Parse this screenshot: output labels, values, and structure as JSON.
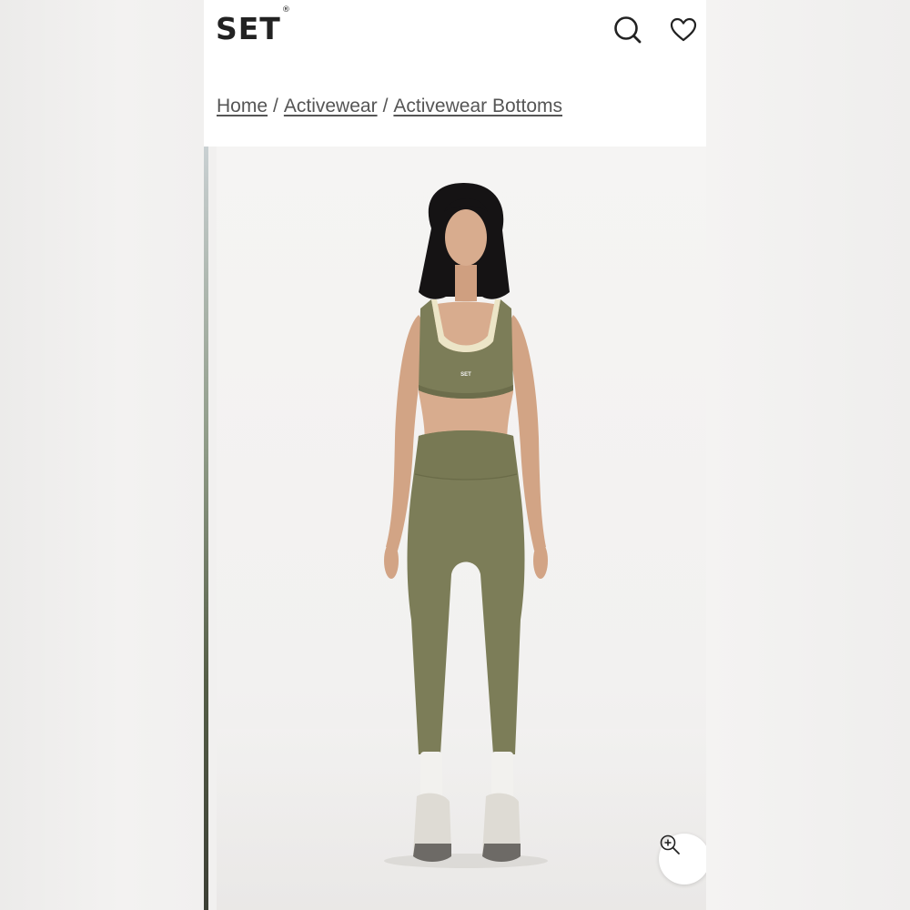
{
  "brand": {
    "logo_text": "SET",
    "logo_mark": "®"
  },
  "header": {
    "icons": [
      "search-icon",
      "heart-icon"
    ]
  },
  "breadcrumb": [
    {
      "label": "Home"
    },
    {
      "label": "Activewear"
    },
    {
      "label": "Activewear Bottoms"
    }
  ],
  "breadcrumb_separator": "/",
  "product_image": {
    "print_on_top": "SET",
    "colors": {
      "garment": "#7c7d58",
      "trim": "#ece5c7",
      "skin": "#d8ac8e",
      "hair": "#151314"
    }
  },
  "gallery": {
    "zoom_icon": "zoom-in-icon"
  }
}
